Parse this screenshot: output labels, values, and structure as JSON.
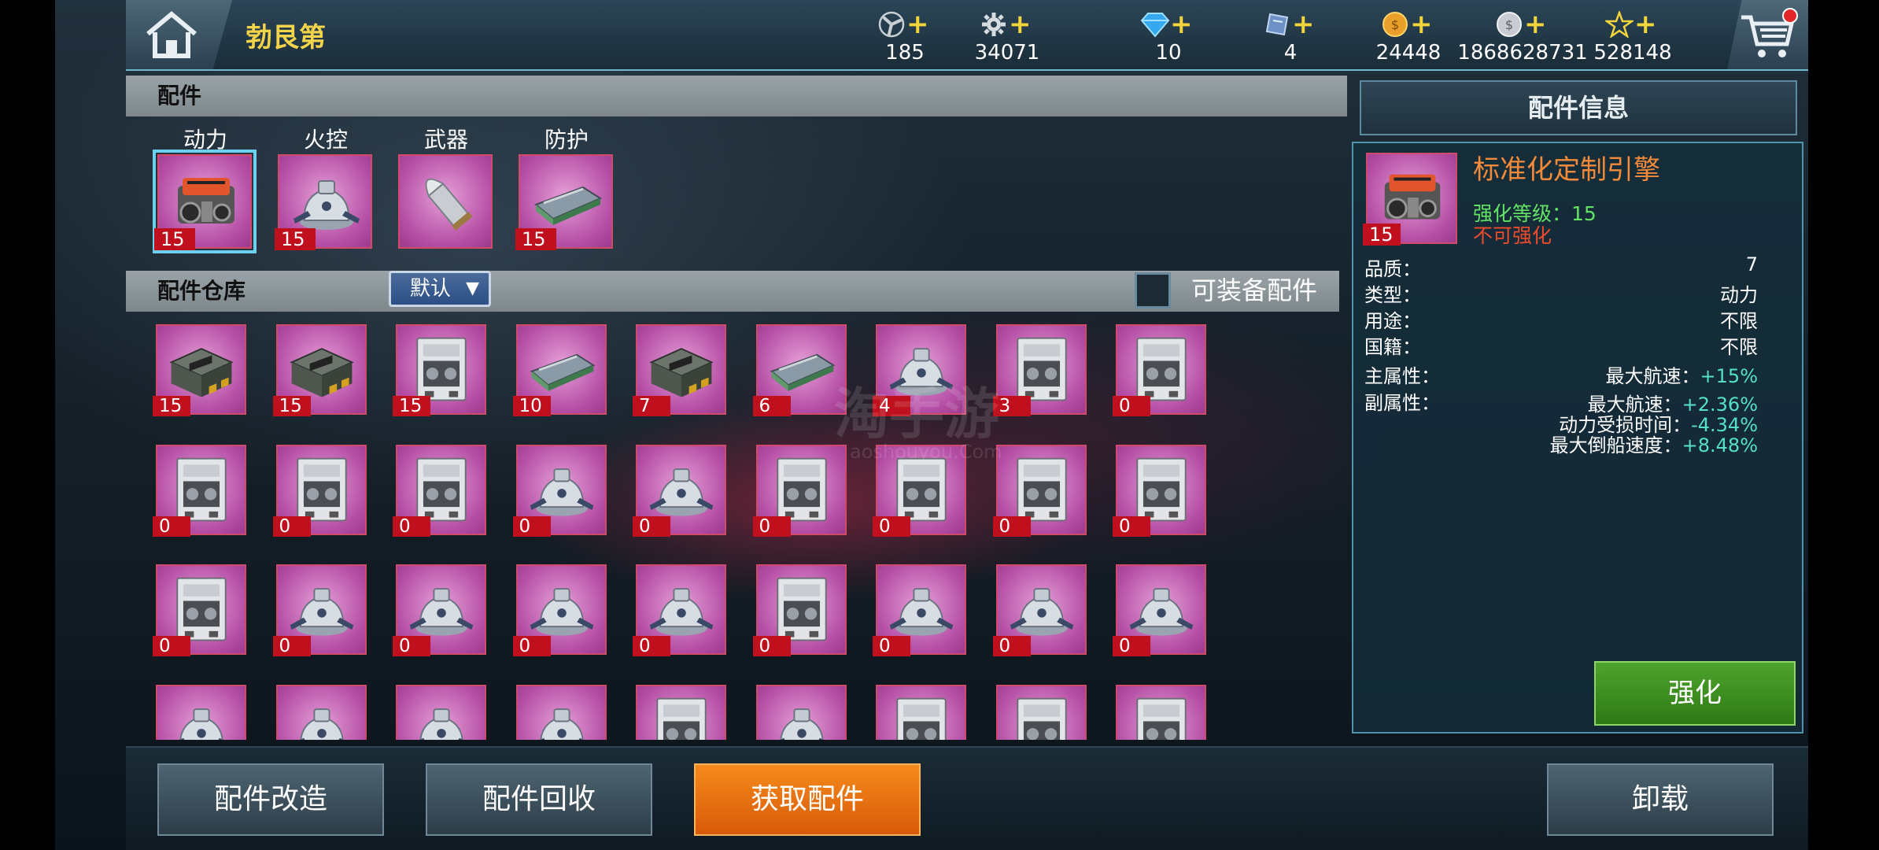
{
  "header": {
    "player_name": "勃艮第",
    "resources": [
      {
        "icon": "propeller-icon",
        "value": "185"
      },
      {
        "icon": "gear-icon",
        "value": "34071"
      },
      {
        "icon": "diamond-icon",
        "value": "10"
      },
      {
        "icon": "ticket-icon",
        "value": "4"
      },
      {
        "icon": "gold-coin-icon",
        "value": "24448"
      },
      {
        "icon": "silver-coin-icon",
        "value": "1868628731"
      },
      {
        "icon": "star-icon",
        "value": "528148"
      }
    ]
  },
  "parts": {
    "title": "配件",
    "categories": [
      {
        "label": "动力",
        "level": "15",
        "selected": true,
        "icon": "engine-icon"
      },
      {
        "label": "火控",
        "level": "15",
        "selected": false,
        "icon": "turret-icon"
      },
      {
        "label": "武器",
        "level": "",
        "selected": false,
        "icon": "shell-icon"
      },
      {
        "label": "防护",
        "level": "15",
        "selected": false,
        "icon": "armor-plate-icon"
      }
    ]
  },
  "warehouse": {
    "title": "配件仓库",
    "sort_label": "默认",
    "filter_label": "可装备配件",
    "items": [
      {
        "icon": "crate-icon",
        "level": "15"
      },
      {
        "icon": "crate-icon",
        "level": "15"
      },
      {
        "icon": "machine-icon",
        "level": "15"
      },
      {
        "icon": "armor-plate-icon",
        "level": "10"
      },
      {
        "icon": "crate-icon",
        "level": "7"
      },
      {
        "icon": "armor-plate-icon",
        "level": "6"
      },
      {
        "icon": "turret-icon",
        "level": "4"
      },
      {
        "icon": "machine-icon",
        "level": "3"
      },
      {
        "icon": "machine-icon",
        "level": "0"
      },
      {
        "icon": "machine-icon",
        "level": "0"
      },
      {
        "icon": "machine-icon",
        "level": "0"
      },
      {
        "icon": "machine-icon",
        "level": "0"
      },
      {
        "icon": "turret-icon",
        "level": "0"
      },
      {
        "icon": "turret-icon",
        "level": "0"
      },
      {
        "icon": "machine-icon",
        "level": "0"
      },
      {
        "icon": "machine-icon",
        "level": "0"
      },
      {
        "icon": "machine-icon",
        "level": "0"
      },
      {
        "icon": "machine-icon",
        "level": "0"
      },
      {
        "icon": "machine-icon",
        "level": "0"
      },
      {
        "icon": "turret-icon",
        "level": "0"
      },
      {
        "icon": "turret-icon",
        "level": "0"
      },
      {
        "icon": "turret-icon",
        "level": "0"
      },
      {
        "icon": "turret-icon",
        "level": "0"
      },
      {
        "icon": "machine-icon",
        "level": "0"
      },
      {
        "icon": "turret-icon",
        "level": "0"
      },
      {
        "icon": "turret-icon",
        "level": "0"
      },
      {
        "icon": "turret-icon",
        "level": "0"
      },
      {
        "icon": "turret-icon",
        "level": ""
      },
      {
        "icon": "turret-icon",
        "level": ""
      },
      {
        "icon": "turret-icon",
        "level": ""
      },
      {
        "icon": "turret-icon",
        "level": ""
      },
      {
        "icon": "machine-icon",
        "level": ""
      },
      {
        "icon": "turret-icon",
        "level": ""
      },
      {
        "icon": "machine-icon",
        "level": ""
      },
      {
        "icon": "machine-icon",
        "level": ""
      },
      {
        "icon": "machine-icon",
        "level": ""
      }
    ]
  },
  "info": {
    "title": "配件信息",
    "part_name": "标准化定制引擎",
    "level": "15",
    "enhance_level": "强化等级：15",
    "not_enhanceable": "不可强化",
    "props": [
      {
        "key": "品质：",
        "value": "7"
      },
      {
        "key": "类型：",
        "value": "动力"
      },
      {
        "key": "用途：",
        "value": "不限"
      },
      {
        "key": "国籍：",
        "value": "不限"
      }
    ],
    "main_attr_label": "主属性：",
    "main_attr_name": "最大航速：",
    "main_attr_value": "+15%",
    "sub_attr_label": "副属性：",
    "sub_attrs": [
      {
        "name": "最大航速：",
        "value": "+2.36%"
      },
      {
        "name": "动力受损时间：",
        "value": "-4.34%"
      },
      {
        "name": "最大倒船速度：",
        "value": "+8.48%"
      }
    ],
    "enhance_button": "强化"
  },
  "bottom": {
    "modify_button": "配件改造",
    "recycle_button": "配件回收",
    "obtain_button": "获取配件",
    "unload_button": "卸载"
  },
  "watermark": "淘手游",
  "watermark_url": "aoshouyou.Com"
}
